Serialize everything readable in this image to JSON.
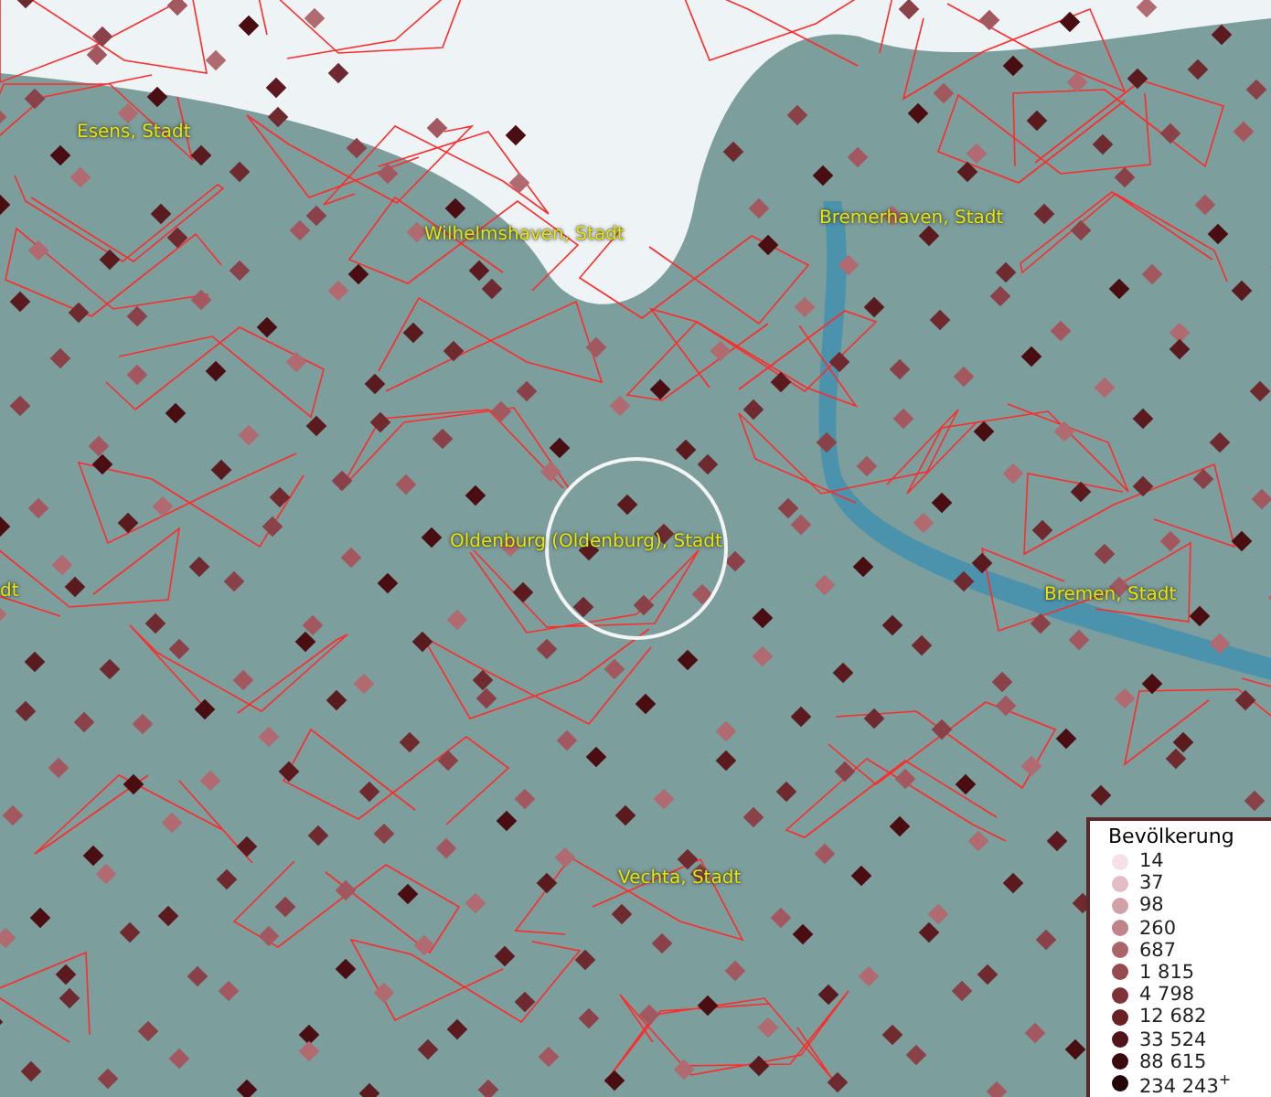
{
  "map": {
    "places": [
      {
        "name": "Esens, Stadt"
      },
      {
        "name": "Wilhelmshaven, Stadt"
      },
      {
        "name": "Bremerhaven, Stadt"
      },
      {
        "name": "Oldenburg (Oldenburg), Stadt"
      },
      {
        "name": "dt"
      },
      {
        "name": "Bremen, Stadt"
      },
      {
        "name": "Vechta, Stadt"
      }
    ]
  },
  "legend": {
    "title": "Bevölkerung",
    "classes": [
      {
        "label": "14",
        "color": "#f6e1ea"
      },
      {
        "label": "37",
        "color": "#e3bcc5"
      },
      {
        "label": "98",
        "color": "#d0a1a8"
      },
      {
        "label": "260",
        "color": "#bf8389"
      },
      {
        "label": "687",
        "color": "#ab6468"
      },
      {
        "label": "1 815",
        "color": "#964a4e"
      },
      {
        "label": "4 798",
        "color": "#7f3337"
      },
      {
        "label": "12 682",
        "color": "#6a2126"
      },
      {
        "label": "33 524",
        "color": "#511418"
      },
      {
        "label": "88 615",
        "color": "#3a0a0e"
      },
      {
        "label": "234 243",
        "color": "#240407",
        "suffix": "+"
      }
    ]
  }
}
